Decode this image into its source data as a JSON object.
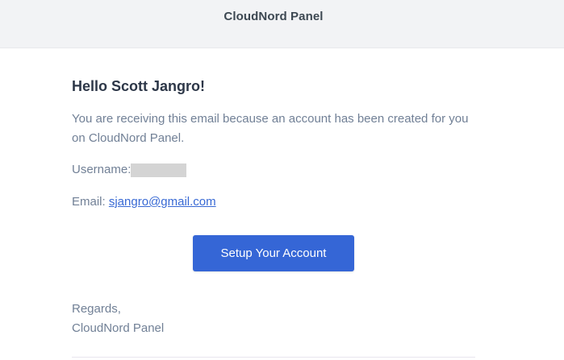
{
  "header": {
    "title": "CloudNord Panel"
  },
  "email": {
    "greeting": "Hello Scott Jangro!",
    "intro": "You are receiving this email because an account has been created for you on CloudNord Panel.",
    "username_label": "Username:",
    "email_label": "Email: ",
    "email_address": "sjangro@gmail.com",
    "button_label": "Setup Your Account",
    "regards_line1": "Regards,",
    "regards_line2": "CloudNord Panel"
  },
  "colors": {
    "header_bg": "#f2f3f5",
    "button_bg": "#3566d6",
    "link": "#3869d4",
    "body_text": "#718096",
    "heading_text": "#2d3748"
  }
}
